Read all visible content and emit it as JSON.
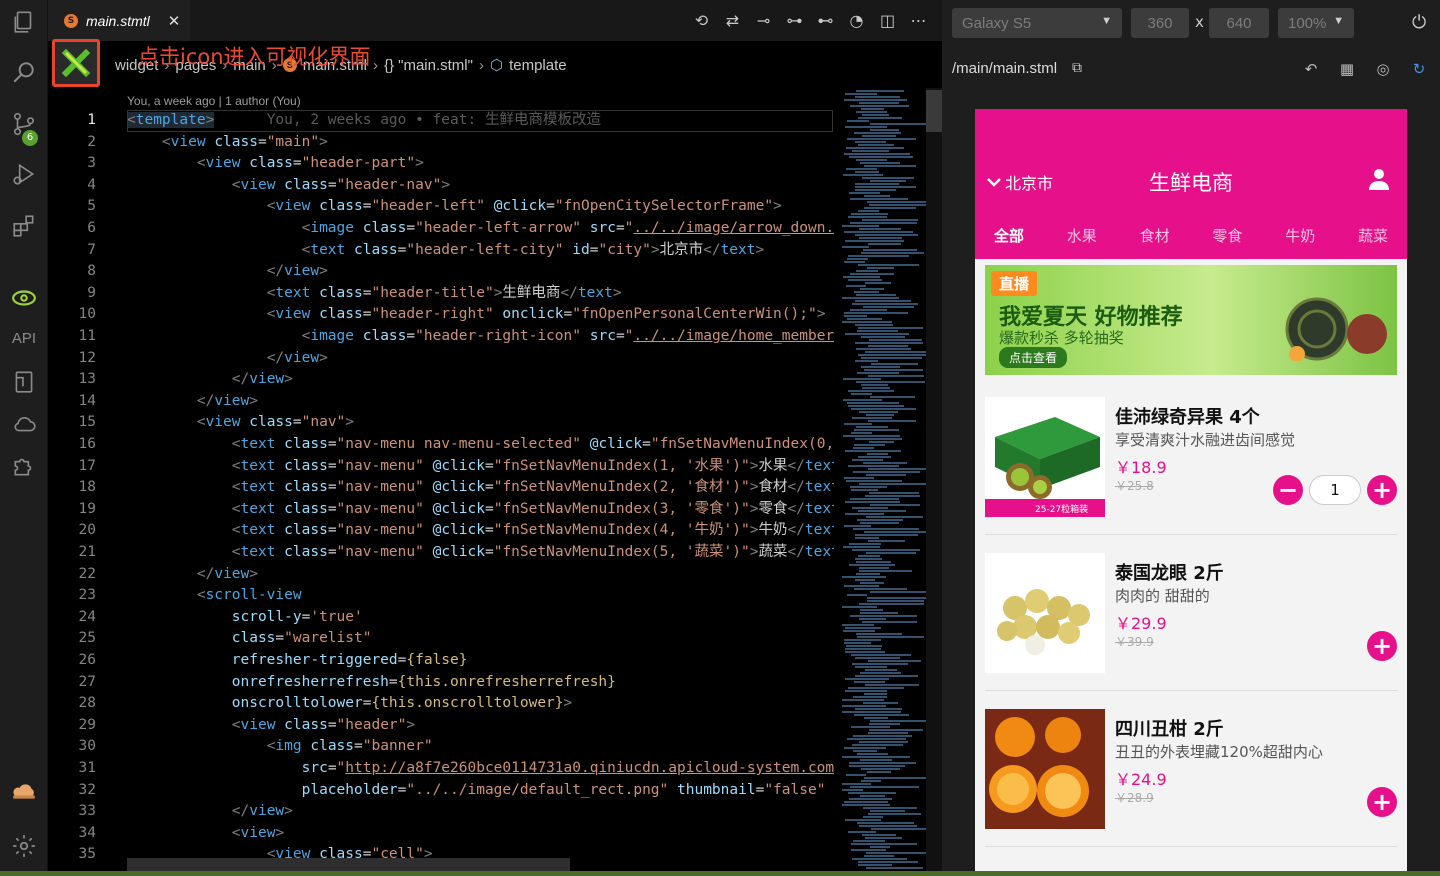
{
  "editor": {
    "tab_name": "main.stmtl",
    "tab_badge": "S",
    "close_glyph": "✕",
    "breadcrumb": [
      "widget",
      "pages",
      "main",
      "main.stml",
      "{} \"main.stml\"",
      "template"
    ],
    "annotation": "点击icon进入可视化界面",
    "blame": "You, a week ago | 1 author (You)",
    "ghost_text": "You, 2 weeks ago • feat: 生鲜电商模板改造"
  },
  "activity": {
    "scm_badge": "6",
    "api_label": "API"
  },
  "simulator": {
    "device": "Galaxy S5",
    "width": "360",
    "height": "640",
    "zoom": "100%",
    "times": "x",
    "path": "/main/main.stml"
  },
  "app": {
    "city": "北京市",
    "title": "生鲜电商",
    "nav": [
      "全部",
      "水果",
      "食材",
      "零食",
      "牛奶",
      "蔬菜"
    ],
    "banner": {
      "tag": "直播",
      "main": "我爱夏天 好物推荐",
      "sub": "爆款秒杀 多轮抽奖",
      "button": "点击查看"
    },
    "items": [
      {
        "name": "佳沛绿奇异果 4个",
        "desc": "享受清爽汁水融进齿间感觉",
        "price": "￥18.9",
        "old": "￥25.8",
        "qty": "1",
        "tag": "25-27粒箱装"
      },
      {
        "name": "泰国龙眼 2斤",
        "desc": "肉肉的 甜甜的",
        "price": "￥29.9",
        "old": "￥39.9"
      },
      {
        "name": "四川丑柑 2斤",
        "desc": "丑丑的外表埋藏120%超甜内心",
        "price": "￥24.9",
        "old": "￥28.9"
      }
    ]
  },
  "colors": {
    "brand": "#e5108a",
    "annotation": "#ea4a33"
  }
}
